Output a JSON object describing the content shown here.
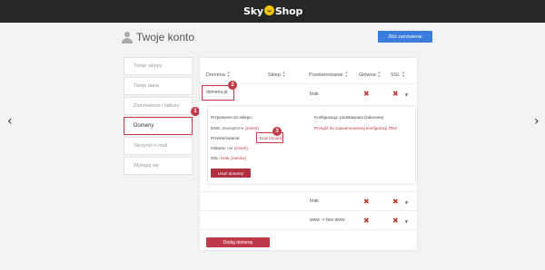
{
  "header": {
    "logo_left": "Sky",
    "logo_right": "Shop"
  },
  "page": {
    "title": "Twoje konto",
    "order_button": "Złóż zamówienie"
  },
  "nav": {
    "prev": "‹",
    "next": "›"
  },
  "sidebar": {
    "items": [
      {
        "label": "Twoje sklepy"
      },
      {
        "label": "Twoje dane"
      },
      {
        "label": "Zamówienia i faktury"
      },
      {
        "label": "Domeny"
      },
      {
        "label": "Skrzynki e-mail"
      },
      {
        "label": "Wyloguj się"
      }
    ]
  },
  "table": {
    "headers": {
      "domain": "Domena",
      "shop": "Sklep",
      "redirect": "Przekierowanie",
      "main": "Główna",
      "ssl": "SSL"
    },
    "rows": [
      {
        "domain": "domena.pl",
        "redirect": "brak"
      },
      {
        "domain": "",
        "redirect": "brak"
      },
      {
        "domain": "",
        "redirect": "www -> bez www"
      }
    ]
  },
  "details": {
    "assign_label": "Przypisanie do sklepu:",
    "dns_label": "DNS:",
    "dns_value": "Zewnętrzne",
    "dns_change": "(zmień)",
    "redirect_label": "Przekierowanie:",
    "redirect_value": "brak (zmień)",
    "main_label": "Główna:",
    "main_value": "nie",
    "main_change": "(zmień)",
    "ssl_label": "SSL:",
    "ssl_value": "brak (zamów)",
    "config_label": "Konfiguracja: podstawowa (zalecana)",
    "config_link": "Przejdź do zaawansowanej konfiguracji DNS",
    "delete_button": "Usuń domenę"
  },
  "add_button": "Dodaj domenę",
  "badges": [
    "1",
    "2",
    "3"
  ],
  "icons": {
    "delete": "✖",
    "caret": "▼",
    "sort_up": "▲",
    "sort_down": "▼"
  },
  "colors": {
    "accent": "#c03a48",
    "primary": "#3b7ddd",
    "topbar": "#262626"
  }
}
